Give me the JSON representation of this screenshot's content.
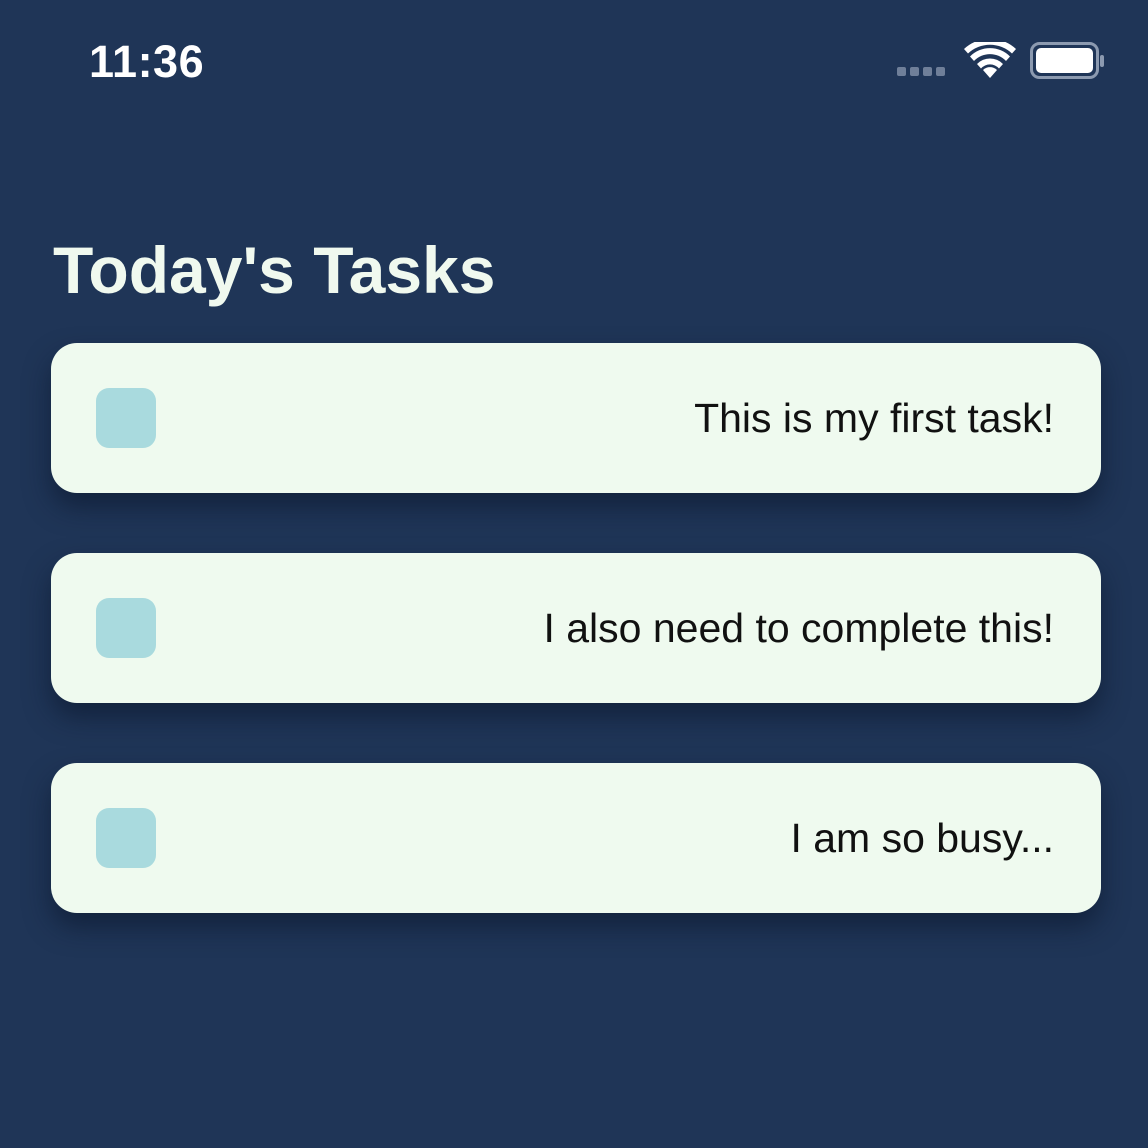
{
  "status_bar": {
    "time": "11:36"
  },
  "colors": {
    "background": "#1f3557",
    "card": "#effaef",
    "checkbox": "#a9dade",
    "title": "#f0f9ef"
  },
  "icons": {
    "signal": "signal-dots-icon",
    "wifi": "wifi-icon",
    "battery": "battery-full-icon"
  },
  "header": {
    "title": "Today's Tasks"
  },
  "tasks": [
    {
      "text": "This is my first task!",
      "done": false
    },
    {
      "text": "I also need to complete this!",
      "done": false
    },
    {
      "text": "I am so busy...",
      "done": false
    }
  ]
}
